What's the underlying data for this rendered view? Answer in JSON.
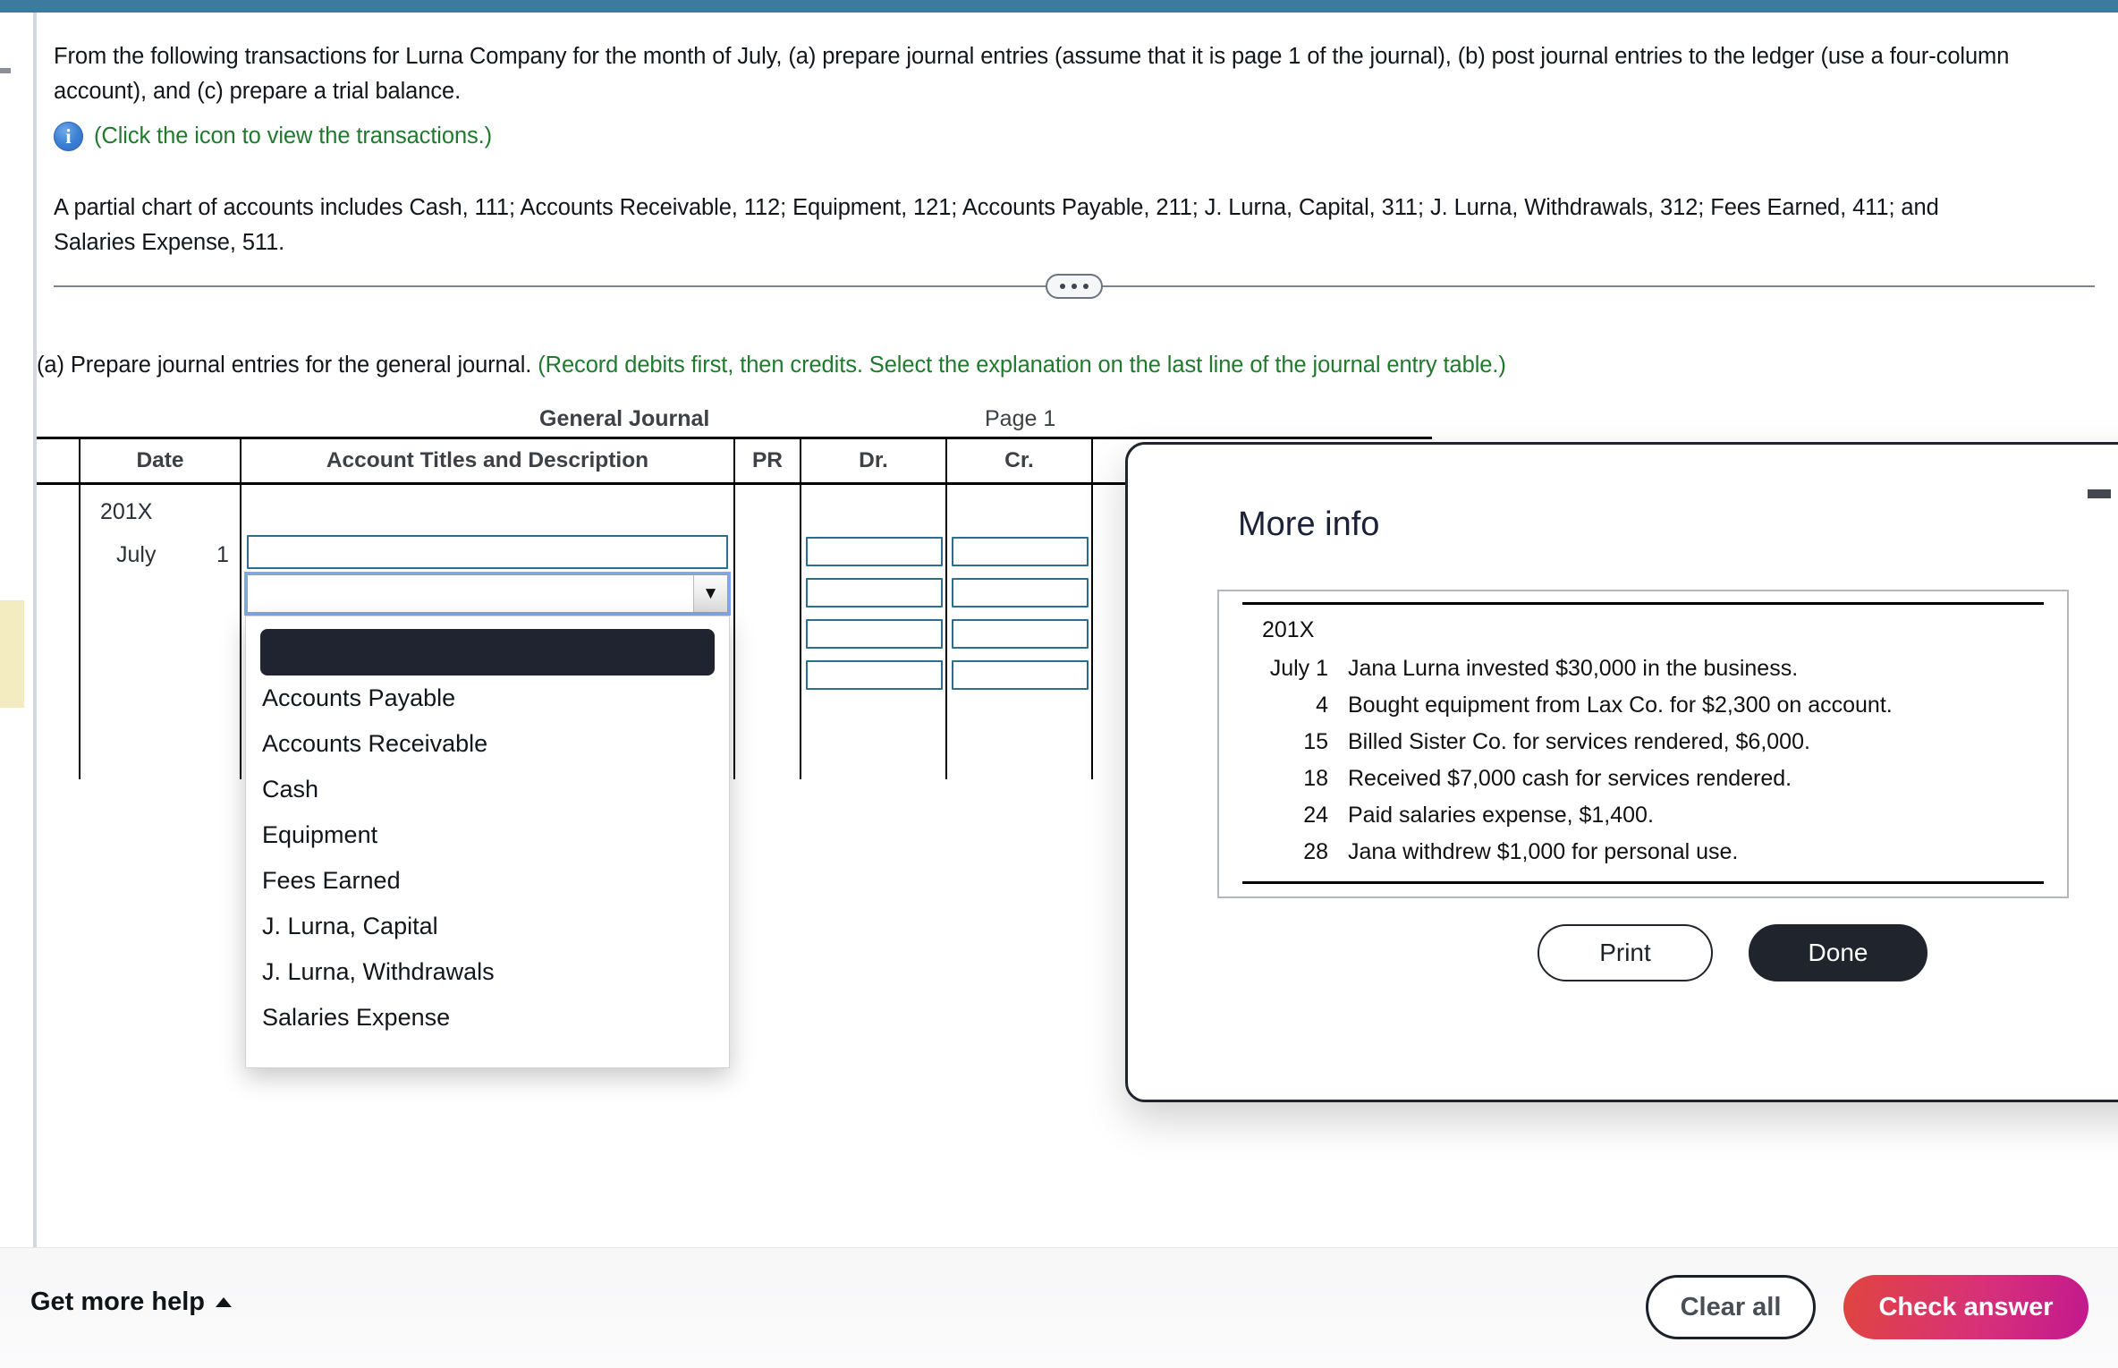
{
  "theme": {
    "top_bar_color": "#3c7b9e",
    "hint_green": "#1f7a2e",
    "field_border": "#2d6e8e",
    "dark": "#20242c",
    "check_gradient_start": "#e0453f",
    "check_gradient_end": "#c2188e"
  },
  "prompt": {
    "line1": "From the following transactions for Lurna Company for the month of July, (a) prepare journal entries (assume that it is page 1 of the journal), (b) post journal entries to the ledger (use a four-column",
    "line2": "account), and (c) prepare a trial balance.",
    "info_icon": "info-icon",
    "info_link": "(Click the icon to view the transactions.)",
    "chart_note_line1": "A partial chart of accounts includes Cash, 111; Accounts Receivable, 112; Equipment, 121; Accounts Payable, 211; J. Lurna, Capital, 311; J. Lurna, Withdrawals, 312; Fees Earned, 411; and",
    "chart_note_line2": "Salaries Expense, 511."
  },
  "part_a": {
    "text": "(a) Prepare journal entries for the general journal. ",
    "hint": "(Record debits first, then credits. Select the explanation on the last line of the journal entry table.)"
  },
  "journal": {
    "title": "General Journal",
    "page": "Page 1",
    "columns": {
      "date": "Date",
      "account": "Account Titles and Description",
      "pr": "PR",
      "dr": "Dr.",
      "cr": "Cr."
    },
    "row": {
      "year": "201X",
      "month": "July",
      "day": "1"
    },
    "account_input_value": "",
    "select_value": "",
    "dropdown_options": [
      "",
      "Accounts Payable",
      "Accounts Receivable",
      "Cash",
      "Equipment",
      "Fees Earned",
      "J. Lurna, Capital",
      "J. Lurna, Withdrawals",
      "Salaries Expense"
    ],
    "dr_values": [
      "",
      "",
      "",
      ""
    ],
    "cr_values": [
      "",
      "",
      "",
      ""
    ]
  },
  "modal": {
    "title": "More info",
    "minimize_icon": "minimize-icon",
    "close_icon": "close-icon",
    "year": "201X",
    "transactions": [
      {
        "date": "July 1",
        "text": "Jana Lurna invested $30,000 in the business."
      },
      {
        "date": "4",
        "text": "Bought equipment from Lax Co. for $2,300 on account."
      },
      {
        "date": "15",
        "text": "Billed Sister Co. for services rendered, $6,000."
      },
      {
        "date": "18",
        "text": "Received $7,000 cash for services rendered."
      },
      {
        "date": "24",
        "text": "Paid salaries expense, $1,400."
      },
      {
        "date": "28",
        "text": "Jana withdrew $1,000 for personal use."
      }
    ],
    "print_label": "Print",
    "done_label": "Done"
  },
  "footer": {
    "get_more_help": "Get more help",
    "caret_icon": "caret-up-icon",
    "clear_all": "Clear all",
    "check_answer": "Check answer"
  }
}
